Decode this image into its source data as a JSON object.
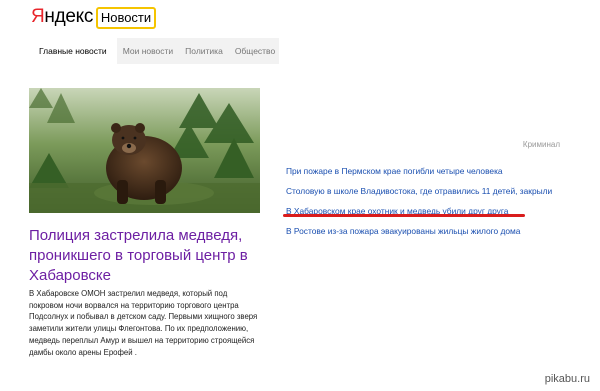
{
  "header": {
    "logo_first": "Я",
    "logo_rest": "ндекс",
    "service": "Новости"
  },
  "tabs": [
    "Главные новости",
    "Мои новости",
    "Политика",
    "Общество"
  ],
  "main_story": {
    "headline": "Полиция застрелила медведя, проникшего в торговый центр в Хабаровске",
    "lead": "В Хабаровске ОМОН застрелил медведя, который под покровом ночи ворвался на территорию торгового центра Подсолнух и побывал в детском саду. Первыми хищного зверя заметили жители улицы Флегонтова. По их предположению, медведь переплыл Амур и вышел на территорию строящейся дамбы около арены Ерофей ."
  },
  "side": {
    "category": "Криминал",
    "news": [
      "При пожаре в Пермском крае погибли четыре человека",
      "Столовую в школе Владивостока, где отравились 11 детей, закрыли",
      "В Хабаровском крае охотник и медведь убили друг друга",
      "В Ростове из-за пожара эвакуированы жильцы жилого дома"
    ],
    "highlight_color": "#d91c1c"
  },
  "watermark": "pikabu.ru",
  "colors": {
    "brand_red": "#e8262c",
    "badge_yellow": "#f5c400",
    "headline_purple": "#6d1fa3",
    "link_blue": "#1a4fb0"
  }
}
